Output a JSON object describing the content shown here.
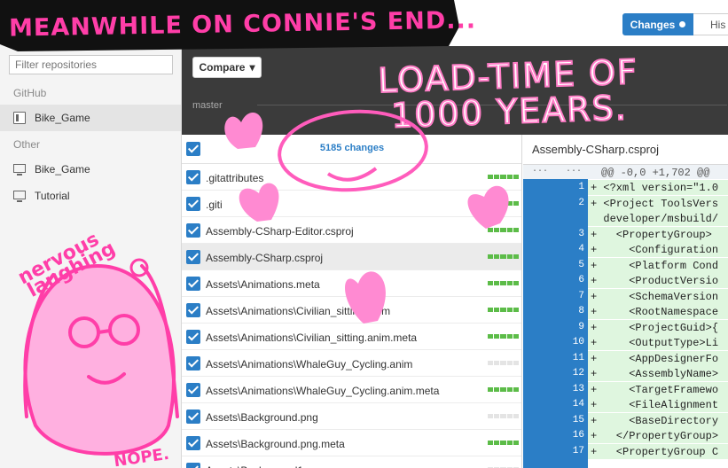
{
  "sidebar": {
    "filter_placeholder": "Filter repositories",
    "sections": [
      {
        "label": "GitHub"
      },
      {
        "label": "Other"
      }
    ],
    "items": [
      {
        "label": "Bike_Game",
        "icon": "repo-icon",
        "selected": true
      },
      {
        "label": "Bike_Game",
        "icon": "monitor-icon",
        "selected": false
      },
      {
        "label": "Tutorial",
        "icon": "monitor-icon",
        "selected": false
      }
    ]
  },
  "toolbar": {
    "compare_label": "Compare",
    "compare_caret": "▾",
    "branch": "master"
  },
  "tabs": {
    "changes_label": "Changes",
    "history_label": "His"
  },
  "changes": {
    "count_label": "5185 changes",
    "files": [
      {
        "name": ".gitattributes",
        "diff": "added"
      },
      {
        "name": ".giti",
        "diff": "added"
      },
      {
        "name": "Assembly-CSharp-Editor.csproj",
        "diff": "added"
      },
      {
        "name": "Assembly-CSharp.csproj",
        "diff": "added",
        "selected": true
      },
      {
        "name": "Assets\\Animations.meta",
        "diff": "added"
      },
      {
        "name": "Assets\\Animations\\Civilian_sitting.anim",
        "diff": "added"
      },
      {
        "name": "Assets\\Animations\\Civilian_sitting.anim.meta",
        "diff": "added"
      },
      {
        "name": "Assets\\Animations\\WhaleGuy_Cycling.anim",
        "diff": "none"
      },
      {
        "name": "Assets\\Animations\\WhaleGuy_Cycling.anim.meta",
        "diff": "added"
      },
      {
        "name": "Assets\\Background.png",
        "diff": "none"
      },
      {
        "name": "Assets\\Background.png.meta",
        "diff": "added"
      },
      {
        "name": "Assets\\Background1...",
        "diff": "none"
      }
    ]
  },
  "diff": {
    "title": "Assembly-CSharp.csproj",
    "hunk_dots": "···",
    "hunk": "@@ -0,0 +1,702 @@",
    "lines": [
      {
        "n": "1",
        "text": "+ <?xml version=\"1.0"
      },
      {
        "n": "2",
        "text": "+ <Project ToolsVers"
      },
      {
        "n": "",
        "text": "  developer/msbuild/"
      },
      {
        "n": "3",
        "text": "+   <PropertyGroup>"
      },
      {
        "n": "4",
        "text": "+     <Configuration"
      },
      {
        "n": "5",
        "text": "+     <Platform Cond"
      },
      {
        "n": "6",
        "text": "+     <ProductVersio"
      },
      {
        "n": "7",
        "text": "+     <SchemaVersion"
      },
      {
        "n": "8",
        "text": "+     <RootNamespace"
      },
      {
        "n": "9",
        "text": "+     <ProjectGuid>{"
      },
      {
        "n": "10",
        "text": "+     <OutputType>Li"
      },
      {
        "n": "11",
        "text": "+     <AppDesignerFo"
      },
      {
        "n": "12",
        "text": "+     <AssemblyName>"
      },
      {
        "n": "13",
        "text": "+     <TargetFramewo"
      },
      {
        "n": "14",
        "text": "+     <FileAlignment"
      },
      {
        "n": "15",
        "text": "+     <BaseDirectory"
      },
      {
        "n": "16",
        "text": "+   </PropertyGroup>"
      },
      {
        "n": "17",
        "text": "+   <PropertyGroup C"
      }
    ]
  },
  "annotations": {
    "banner": "MEANWHILE ON CONNIE'S END...",
    "loadtime_line1": "LOAD-TIME OF",
    "loadtime_line2": "1000 YEARS.",
    "nervous1": "nervous",
    "nervous2": "laughing",
    "nope": "NOPE.",
    "accent": "#ff3ea8"
  }
}
